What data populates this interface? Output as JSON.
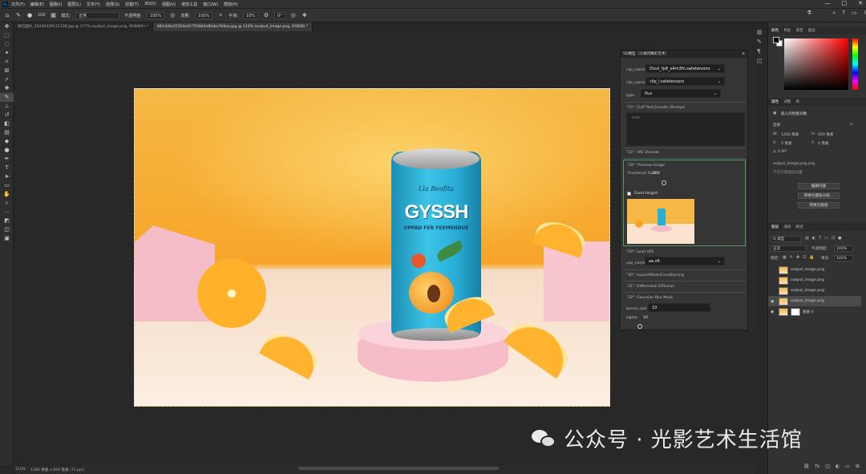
{
  "menubar": {
    "items": [
      "文件(F)",
      "编辑(E)",
      "图像(I)",
      "图层(L)",
      "文字(Y)",
      "选择(S)",
      "滤镜(T)",
      "3D(D)",
      "视图(V)",
      "增效工具",
      "窗口(W)",
      "帮助(H)"
    ]
  },
  "window_controls": {
    "minimize": "—",
    "maximize": "□",
    "close": "✕"
  },
  "options": {
    "brush_size": "100",
    "mode_label": "模式:",
    "mode_value": "正常",
    "opacity_label": "不透明度:",
    "opacity_value": "100%",
    "flow_label": "流量:",
    "flow_value": "100%",
    "smooth_label": "平滑:",
    "smooth_value": "10%",
    "angle_value": "0°"
  },
  "tabs": [
    {
      "label": "微信图片_20240429111338.jpg @ 177% (output_image.png, RGB/8#) *",
      "active": false
    },
    {
      "label": "081cb9a3535de427504b5e8febe7b9aa.jpg @ 110% (output_image.png, RGB/8) *",
      "active": true
    }
  ],
  "status": {
    "zoom": "110%",
    "info": "1280 像素 x 859 像素 (72 ppi)"
  },
  "canvas_image": {
    "can_brand": "Lla Beofita",
    "can_title": "GYSSH",
    "can_subtitle": "UPPAD FER FEEMENDUE"
  },
  "comfy": {
    "title": "5D模型（沙滩的精彩艺术）",
    "clip_name1_label": "clip_name1",
    "clip_name1_value": "t5xxl_fp8_e4m3fn.safetensors",
    "clip_name2_label": "clip_name2",
    "clip_name2_value": "clip_l.safetensors",
    "type_label": "type",
    "type_value": "flux",
    "node_clip_text": "\"15\": CLIP Text Encode (Prompt)",
    "text_placeholder": "text",
    "node_vae_decode": "\"23\": VAE Decode",
    "node_preview": "\"28\": Preview Image",
    "thumb_label": "Thumbnail Size:",
    "thumb_value": "200",
    "fixed_height_label": "Fixed Height:",
    "node_load_vae": "\"29\": Load VAE",
    "vae_name_label": "vae_name",
    "vae_name_value": "ae.sft",
    "node_inpaint": "\"30\": InpaintModelConditioning",
    "node_diffusion": "\"31\": Differential Diffusion",
    "node_blur": "\"32\": Gaussian Blur Mask",
    "kernel_label": "kernel_size",
    "kernel_value": "10",
    "sigma_label": "sigma",
    "sigma_value": "10"
  },
  "right_panel": {
    "color_tabs": [
      "颜色",
      "色板",
      "渐变",
      "图案"
    ],
    "props_tabs": [
      "属性",
      "调整",
      "库"
    ],
    "smart_object": "嵌入的智能对象",
    "transform_label": "变换",
    "w_label": "W:",
    "w_value": "1280 像素",
    "h_label": "H:",
    "h_value": "859 像素",
    "x_label": "X:",
    "x_value": "0 像素",
    "y_label": "Y:",
    "y_value": "0 像素",
    "angle": "0.00°",
    "file_name": "output_image.png.png",
    "file_hint": "不在外部图层设置",
    "btn_edit": "编辑内容",
    "btn_convert_layers": "转换为图层分组...",
    "btn_convert_linked": "转换为链接",
    "layers_tabs": [
      "图层",
      "通道",
      "路径"
    ],
    "kind_label": "Q 类型",
    "blend_mode": "正常",
    "opacity_label": "不透明度:",
    "opacity_value": "100%",
    "lock_label": "锁定:",
    "fill_label": "填充:",
    "fill_value": "100%",
    "layers": [
      {
        "name": "output_image.png",
        "visible": false,
        "active": false
      },
      {
        "name": "output_image.png",
        "visible": false,
        "active": false
      },
      {
        "name": "output_image.png",
        "visible": false,
        "active": false
      },
      {
        "name": "output_image.png",
        "visible": true,
        "active": true
      },
      {
        "name": "图层 0",
        "visible": true,
        "active": false
      }
    ]
  },
  "watermark": "公众号 · 光影艺术生活馆",
  "colors": {
    "accent": "#31a8ff",
    "canvas_bg": "#282828",
    "panel_bg": "#323232"
  }
}
